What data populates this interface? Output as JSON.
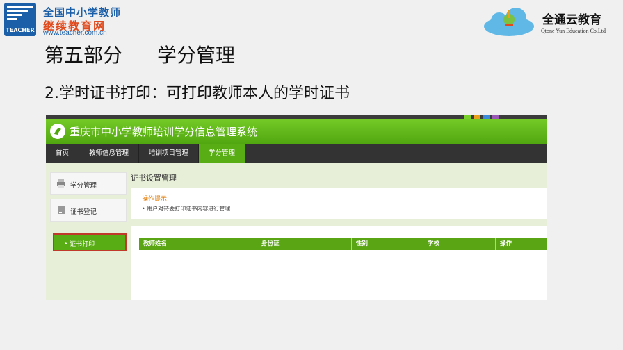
{
  "header": {
    "logo_left": {
      "mark_text": "TEACHER",
      "line1": "全国中小学教师",
      "line2": "继续教育网",
      "line3": "www.teacher.com.cn"
    },
    "logo_right": {
      "name_cn": "全通云教育",
      "name_en": "Qtone Yun Education Co.Ltd"
    }
  },
  "slide": {
    "section": "第五部分",
    "section_name": "学分管理",
    "subtitle": "2.学时证书打印：可打印教师本人的学时证书"
  },
  "app": {
    "system_title": "重庆市中小学教师培训学分信息管理系统",
    "nav": [
      {
        "label": "首页"
      },
      {
        "label": "教师信息管理"
      },
      {
        "label": "培训项目管理"
      },
      {
        "label": "学分管理",
        "active": true
      }
    ],
    "sidebar": [
      {
        "label": "学分管理",
        "icon": "printer-icon"
      },
      {
        "label": "证书登记",
        "icon": "document-icon"
      }
    ],
    "sidebar_active": "• 证书打印",
    "content_title": "证书设置管理",
    "notice_title": "操作提示",
    "notice_text": "• 用户对待要打印证书内容进行管理",
    "table_headers": [
      "教师姓名",
      "身份证",
      "性别",
      "学校",
      "操作"
    ]
  },
  "colors": {
    "accent_green": "#59ad14",
    "nav_dark": "#333333",
    "highlight_border": "#c0392b",
    "notice_orange": "#e27f0c",
    "brand_blue": "#1b5fa8",
    "brand_red": "#e04a1c"
  }
}
